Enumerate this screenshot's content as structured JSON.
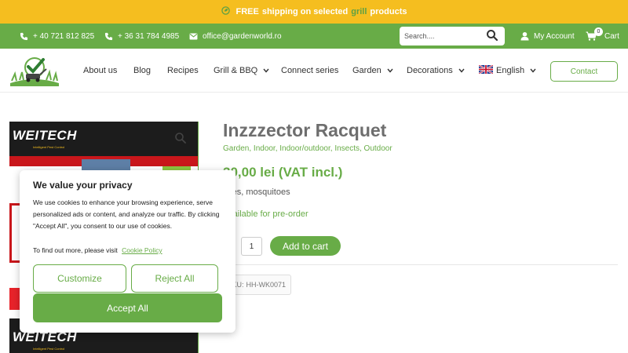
{
  "promo": {
    "free": "FREE",
    "text_before": "shipping on selected",
    "highlight": "grill",
    "text_after": "products"
  },
  "topbar": {
    "phone1": "+ 40 721 812 825",
    "phone2": "+ 36 31 784 4985",
    "email": "office@gardenworld.ro",
    "search_placeholder": "Search....",
    "account": "My Account",
    "cart": "Cart",
    "cart_count": "0"
  },
  "nav": {
    "items": [
      {
        "label": "About us"
      },
      {
        "label": "Blog"
      },
      {
        "label": "Recipes"
      },
      {
        "label": "Grill & BBQ"
      },
      {
        "label": "Connect series"
      },
      {
        "label": "Garden"
      },
      {
        "label": "Decorations"
      },
      {
        "label": "English"
      }
    ],
    "contact": "Contact"
  },
  "product": {
    "brand": "WEITECH",
    "brand_tag": "Intelligent Pest Control",
    "title": "Inzzzector Racquet",
    "categories": "Garden, Indoor, Indoor/outdoor, Insects, Outdoor",
    "price": "30,00 lei (VAT incl.)",
    "description": "Flies, mosquitoes",
    "availability": "Available for pre-order",
    "quantity": "1",
    "add_to_cart": "Add to cart",
    "sku_label": "SKU:",
    "sku": "HH-WK0071"
  },
  "cookie": {
    "title": "We value your privacy",
    "text": "We use cookies to enhance your browsing experience, serve personalized ads or content, and analyze our traffic. By clicking \"Accept All\", you consent to our use of cookies.",
    "find_more": "To find out more, please visit",
    "policy_link": "Cookie Policy",
    "customize": "Customize",
    "reject": "Reject All",
    "accept": "Accept All"
  },
  "colors": {
    "brand_green": "#68ac47",
    "promo_yellow": "#f5be1f",
    "title_gray": "#6e6e6e"
  },
  "icons": [
    "leaf-icon",
    "phone-icon",
    "mail-icon",
    "search-icon",
    "user-icon",
    "cart-icon",
    "chevron-down-icon",
    "uk-flag-icon",
    "zoom-icon"
  ]
}
